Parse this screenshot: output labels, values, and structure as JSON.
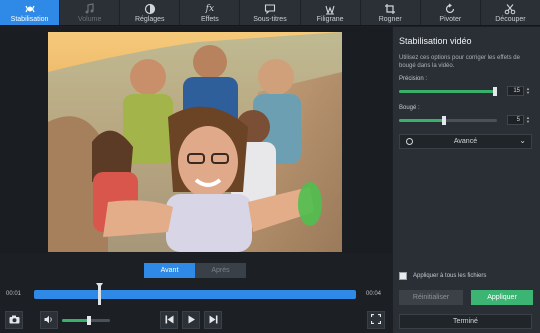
{
  "toolbar": {
    "tabs": [
      {
        "label": "Stabilisation",
        "icon": "stabilisation-icon",
        "state": "active"
      },
      {
        "label": "Volume",
        "icon": "music-note-icon",
        "state": "disabled"
      },
      {
        "label": "Réglages",
        "icon": "contrast-icon",
        "state": "normal"
      },
      {
        "label": "Effets",
        "icon": "fx-icon",
        "state": "normal"
      },
      {
        "label": "Sous-titres",
        "icon": "speech-bubble-icon",
        "state": "normal"
      },
      {
        "label": "Filigrane",
        "icon": "watermark-icon",
        "state": "normal"
      },
      {
        "label": "Rogner",
        "icon": "crop-icon",
        "state": "normal"
      },
      {
        "label": "Pivoter",
        "icon": "rotate-icon",
        "state": "normal"
      },
      {
        "label": "Découper",
        "icon": "scissors-icon",
        "state": "normal"
      }
    ]
  },
  "compare": {
    "before": "Avant",
    "after": "Après"
  },
  "timeline": {
    "start": "00:01",
    "end": "00:04",
    "position": 0.2
  },
  "volume": {
    "level": 0.6
  },
  "panel": {
    "title": "Stabilisation vidéo",
    "description": "Utilisez ces options pour corriger les effets de bougé dans la vidéo.",
    "precision": {
      "label": "Précision :",
      "value": "15",
      "level": 1.0
    },
    "shake": {
      "label": "Bougé :",
      "value": "5",
      "level": 0.48
    },
    "advanced": "Avancé",
    "apply_all": "Appliquer à tous les fichiers",
    "reset": "Réinitialiser",
    "apply": "Appliquer",
    "done": "Terminé"
  },
  "colors": {
    "accent": "#2e8ae6",
    "green": "#3cb473",
    "background": "#1c2025"
  }
}
